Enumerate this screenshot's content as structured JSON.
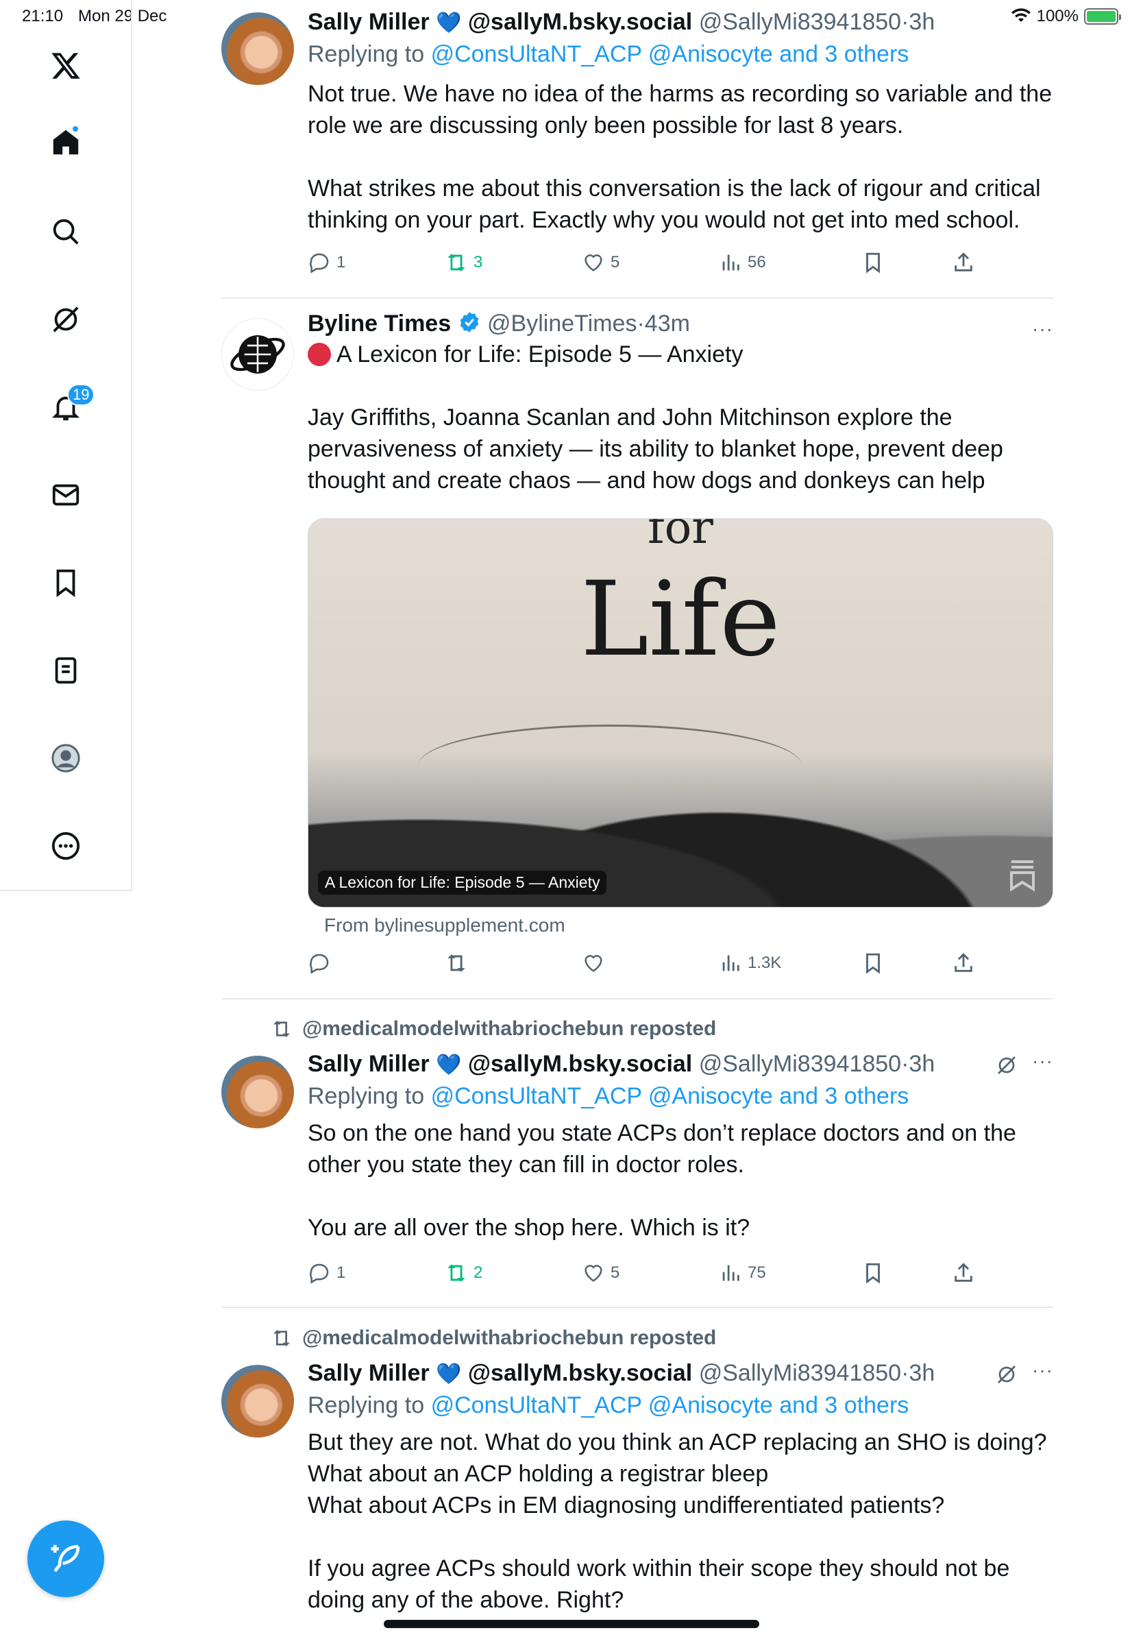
{
  "status_bar": {
    "time": "21:10",
    "date": "Mon 29 Dec",
    "battery": "100%"
  },
  "sidebar": {
    "items": [
      {
        "name": "x-logo"
      },
      {
        "name": "home"
      },
      {
        "name": "search"
      },
      {
        "name": "grok"
      },
      {
        "name": "notifications",
        "badge": "19"
      },
      {
        "name": "messages"
      },
      {
        "name": "bookmarks"
      },
      {
        "name": "lists"
      },
      {
        "name": "profile"
      },
      {
        "name": "more"
      }
    ]
  },
  "tweets": [
    {
      "name": "Sally Miller",
      "verified_heart": true,
      "handle1": "@sallyM.bsky.social",
      "handle2": "@SallyMi83941850",
      "time": "3h",
      "replying_to": "Replying to",
      "reply_users": "@ConsUltaNT_ACP @Anisocyte and 3 others",
      "text": "Not true. We have no idea of the harms as recording so variable and the role we are discussing only been possible for last 8 years.\n\nWhat strikes me about this conversation is the lack of rigour and critical thinking on your part. Exactly why you would not get into med school.",
      "replies": "1",
      "reposts": "3",
      "likes": "5",
      "views": "56"
    },
    {
      "name": "Byline Times",
      "handle2": "@BylineTimes",
      "time": "43m",
      "headline": "A Lexicon for Life: Episode 5 — Anxiety",
      "text": "Jay Griffiths, Joanna Scanlan and John Mitchinson explore the pervasiveness of anxiety — its ability to blanket hope, prevent deep thought and create chaos — and how dogs and donkeys can help",
      "card": {
        "top_word": "for",
        "big_word": "Life",
        "caption": "A Lexicon for Life: Episode 5 — Anxiety",
        "from": "From bylinesupplement.com"
      },
      "views": "1.3K"
    },
    {
      "reposted_by": "@medicalmodelwithabriochebun reposted",
      "name": "Sally Miller",
      "handle1": "@sallyM.bsky.social",
      "handle2": "@SallyMi83941850",
      "time": "3h",
      "replying_to": "Replying to",
      "reply_users": "@ConsUltaNT_ACP @Anisocyte and 3 others",
      "text": "So on the one hand you state ACPs don’t replace doctors and on the other you state they can fill in doctor roles.\n\nYou are all over the shop here. Which is it?",
      "replies": "1",
      "reposts": "2",
      "likes": "5",
      "views": "75"
    },
    {
      "reposted_by": "@medicalmodelwithabriochebun reposted",
      "name": "Sally Miller",
      "handle1": "@sallyM.bsky.social",
      "handle2": "@SallyMi83941850",
      "time": "3h",
      "replying_to": "Replying to",
      "reply_users": "@ConsUltaNT_ACP @Anisocyte and 3 others",
      "text": "But they are not. What do you think an ACP replacing an SHO is doing?\nWhat about an ACP holding a registrar bleep\nWhat about ACPs in EM diagnosing undifferentiated patients?\n\nIf you agree ACPs should work within their scope they should not be doing any of the above. Right?"
    }
  ],
  "colors": {
    "accent": "#1d9bf0",
    "repost": "#00ba7c",
    "muted": "#536471",
    "text": "#0f1419"
  }
}
